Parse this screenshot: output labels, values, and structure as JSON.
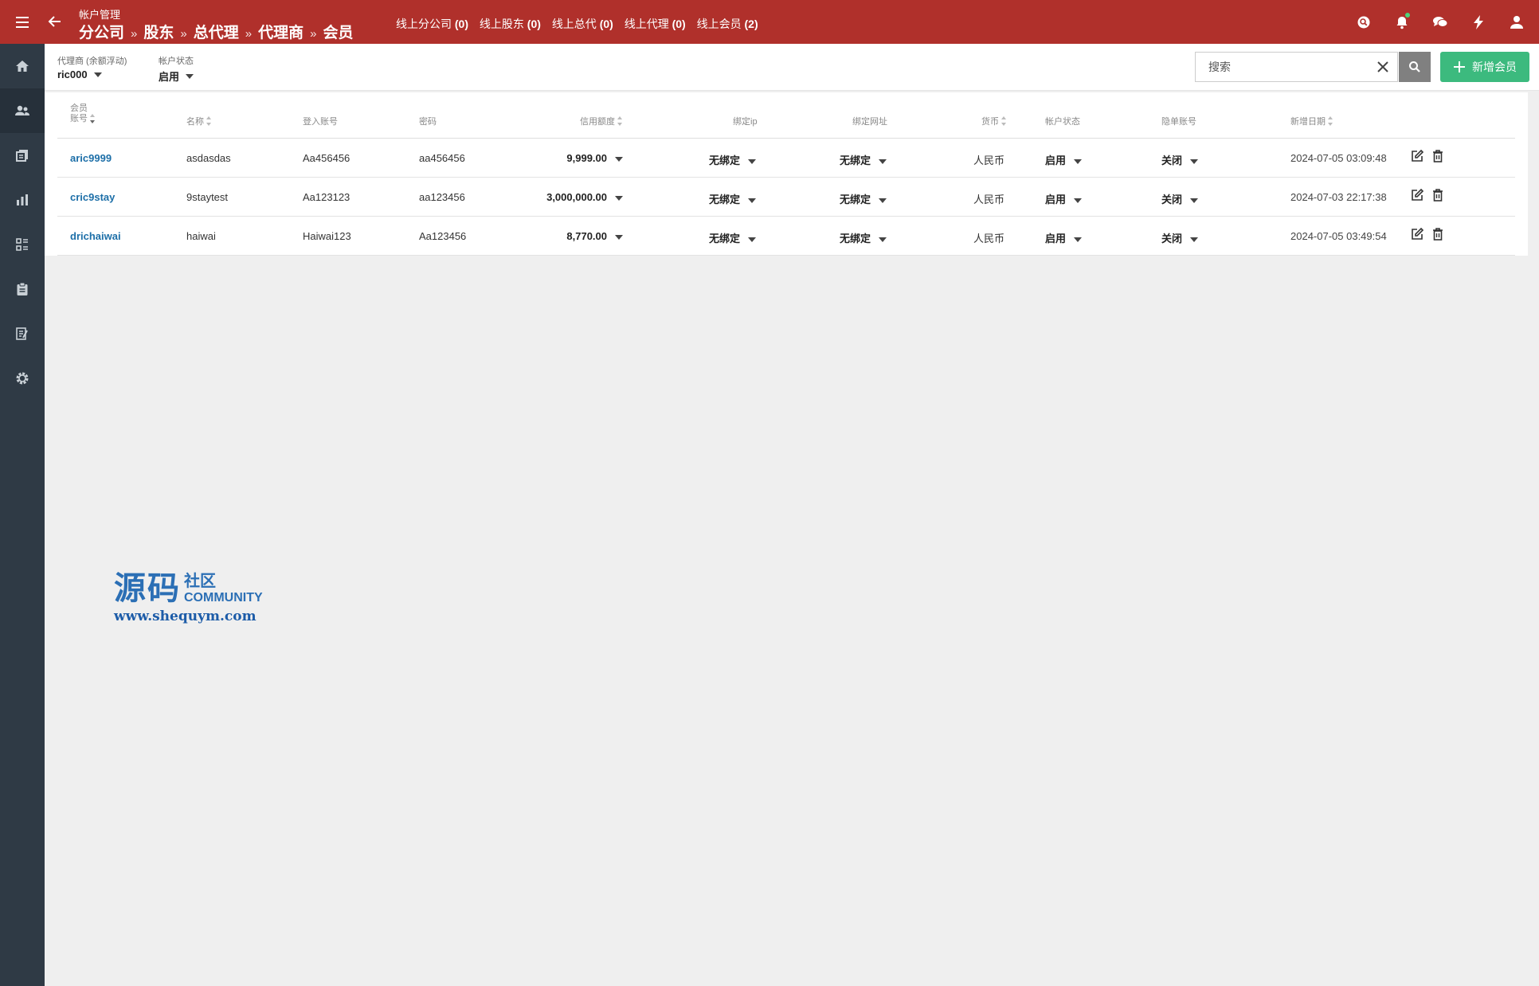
{
  "topbar": {
    "subtitle": "帐户管理",
    "breadcrumbs": [
      "分公司",
      "股东",
      "总代理",
      "代理商",
      "会员"
    ],
    "separator": "»",
    "online": [
      {
        "label": "线上分公司",
        "count": "(0)"
      },
      {
        "label": "线上股东",
        "count": "(0)"
      },
      {
        "label": "线上总代",
        "count": "(0)"
      },
      {
        "label": "线上代理",
        "count": "(0)"
      },
      {
        "label": "线上会员",
        "count": "(2)"
      }
    ]
  },
  "filters": {
    "agent": {
      "label": "代理商 (余额浮动)",
      "value": "ric000"
    },
    "status": {
      "label": "帐户状态",
      "value": "启用"
    }
  },
  "search": {
    "placeholder": "搜索"
  },
  "add_button": {
    "label": "新增会员"
  },
  "table": {
    "headers": {
      "account_line1": "会员",
      "account_line2": "账号",
      "name": "名称",
      "login": "登入账号",
      "password": "密码",
      "credit": "信用额度",
      "bind_ip": "绑定ip",
      "bind_url": "绑定网址",
      "currency": "货币",
      "status": "帐户状态",
      "hidden": "隐单账号",
      "created": "新增日期"
    },
    "rows": [
      {
        "account": "aric9999",
        "name": "asdasdas",
        "login": "Aa456456",
        "password": "aa456456",
        "credit": "9,999.00",
        "bind_ip": "无绑定",
        "bind_url": "无绑定",
        "currency": "人民币",
        "status": "启用",
        "hidden": "关闭",
        "created": "2024-07-05 03:09:48"
      },
      {
        "account": "cric9stay",
        "name": "9staytest",
        "login": "Aa123123",
        "password": "aa123456",
        "credit": "3,000,000.00",
        "bind_ip": "无绑定",
        "bind_url": "无绑定",
        "currency": "人民币",
        "status": "启用",
        "hidden": "关闭",
        "created": "2024-07-03 22:17:38"
      },
      {
        "account": "drichaiwai",
        "name": "haiwai",
        "login": "Haiwai123",
        "password": "Aa123456",
        "credit": "8,770.00",
        "bind_ip": "无绑定",
        "bind_url": "无绑定",
        "currency": "人民币",
        "status": "启用",
        "hidden": "关闭",
        "created": "2024-07-05 03:49:54"
      }
    ]
  },
  "watermark": {
    "chars": "源码",
    "community_cn": "社区",
    "community_en": "COMMUNITY",
    "url": "www.shequym.com"
  }
}
